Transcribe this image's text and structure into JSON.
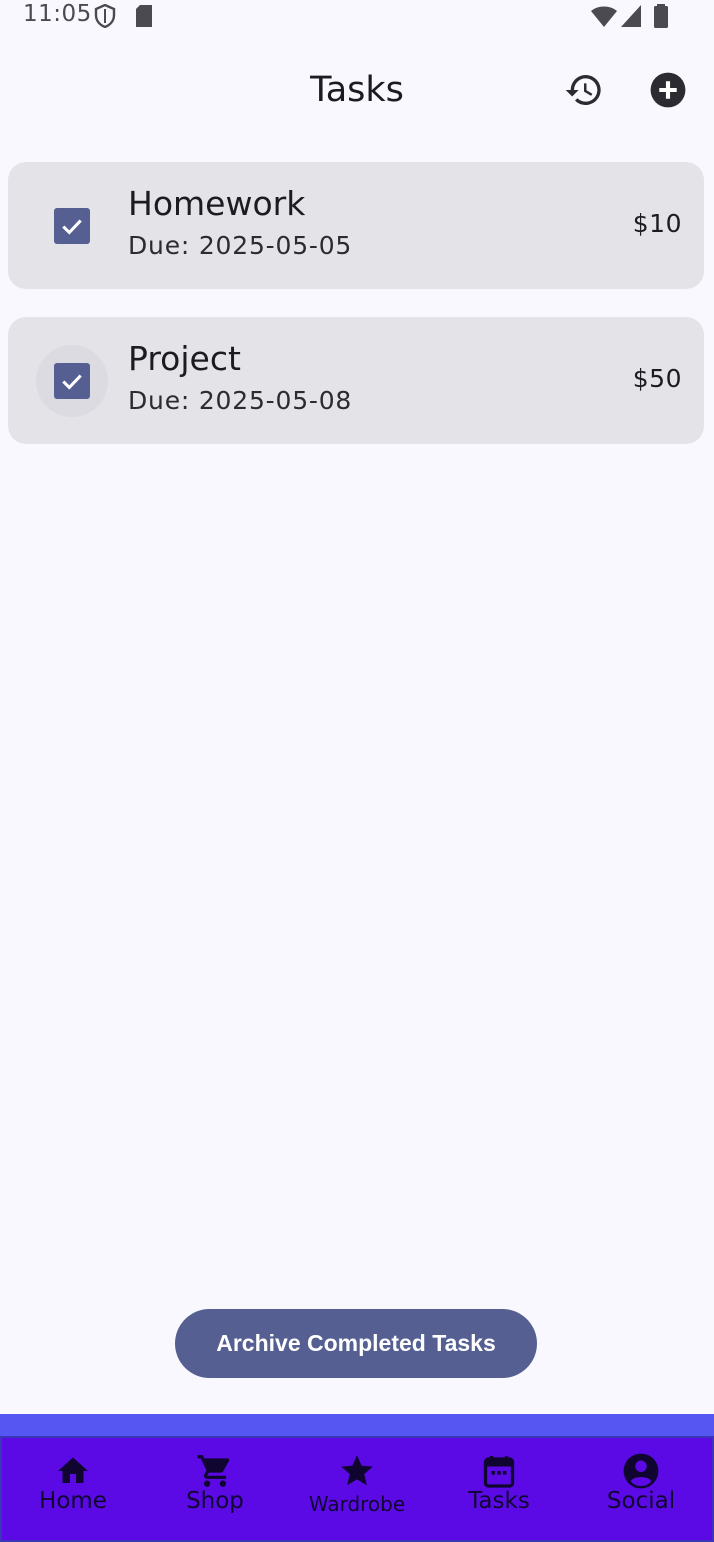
{
  "status_bar": {
    "time": "11:05",
    "left_icons": [
      "shield-icon",
      "sd-card-icon"
    ],
    "right_icons": [
      "wifi-icon",
      "signal-icon",
      "battery-icon"
    ]
  },
  "top_bar": {
    "title": "Tasks",
    "actions": [
      "history-icon",
      "add-circle-icon"
    ]
  },
  "tasks": [
    {
      "title": "Homework",
      "due": "Due: 2025-05-05",
      "reward": "$10",
      "checked": true
    },
    {
      "title": "Project",
      "due": "Due: 2025-05-08",
      "reward": "$50",
      "checked": true
    }
  ],
  "archive_button": {
    "label": "Archive Completed Tasks"
  },
  "bottom_nav": {
    "items": [
      {
        "label": "Home",
        "icon": "home-icon"
      },
      {
        "label": "Shop",
        "icon": "cart-icon"
      },
      {
        "label": "Wardrobe",
        "icon": "star-icon"
      },
      {
        "label": "Tasks",
        "icon": "calendar-icon"
      },
      {
        "label": "Social",
        "icon": "account-circle-icon"
      }
    ]
  },
  "colors": {
    "background": "#f9f8fe",
    "card": "#e4e3e8",
    "accent": "#555f92",
    "nav_background": "#5b0ae6",
    "nav_strip": "#5656f2"
  }
}
